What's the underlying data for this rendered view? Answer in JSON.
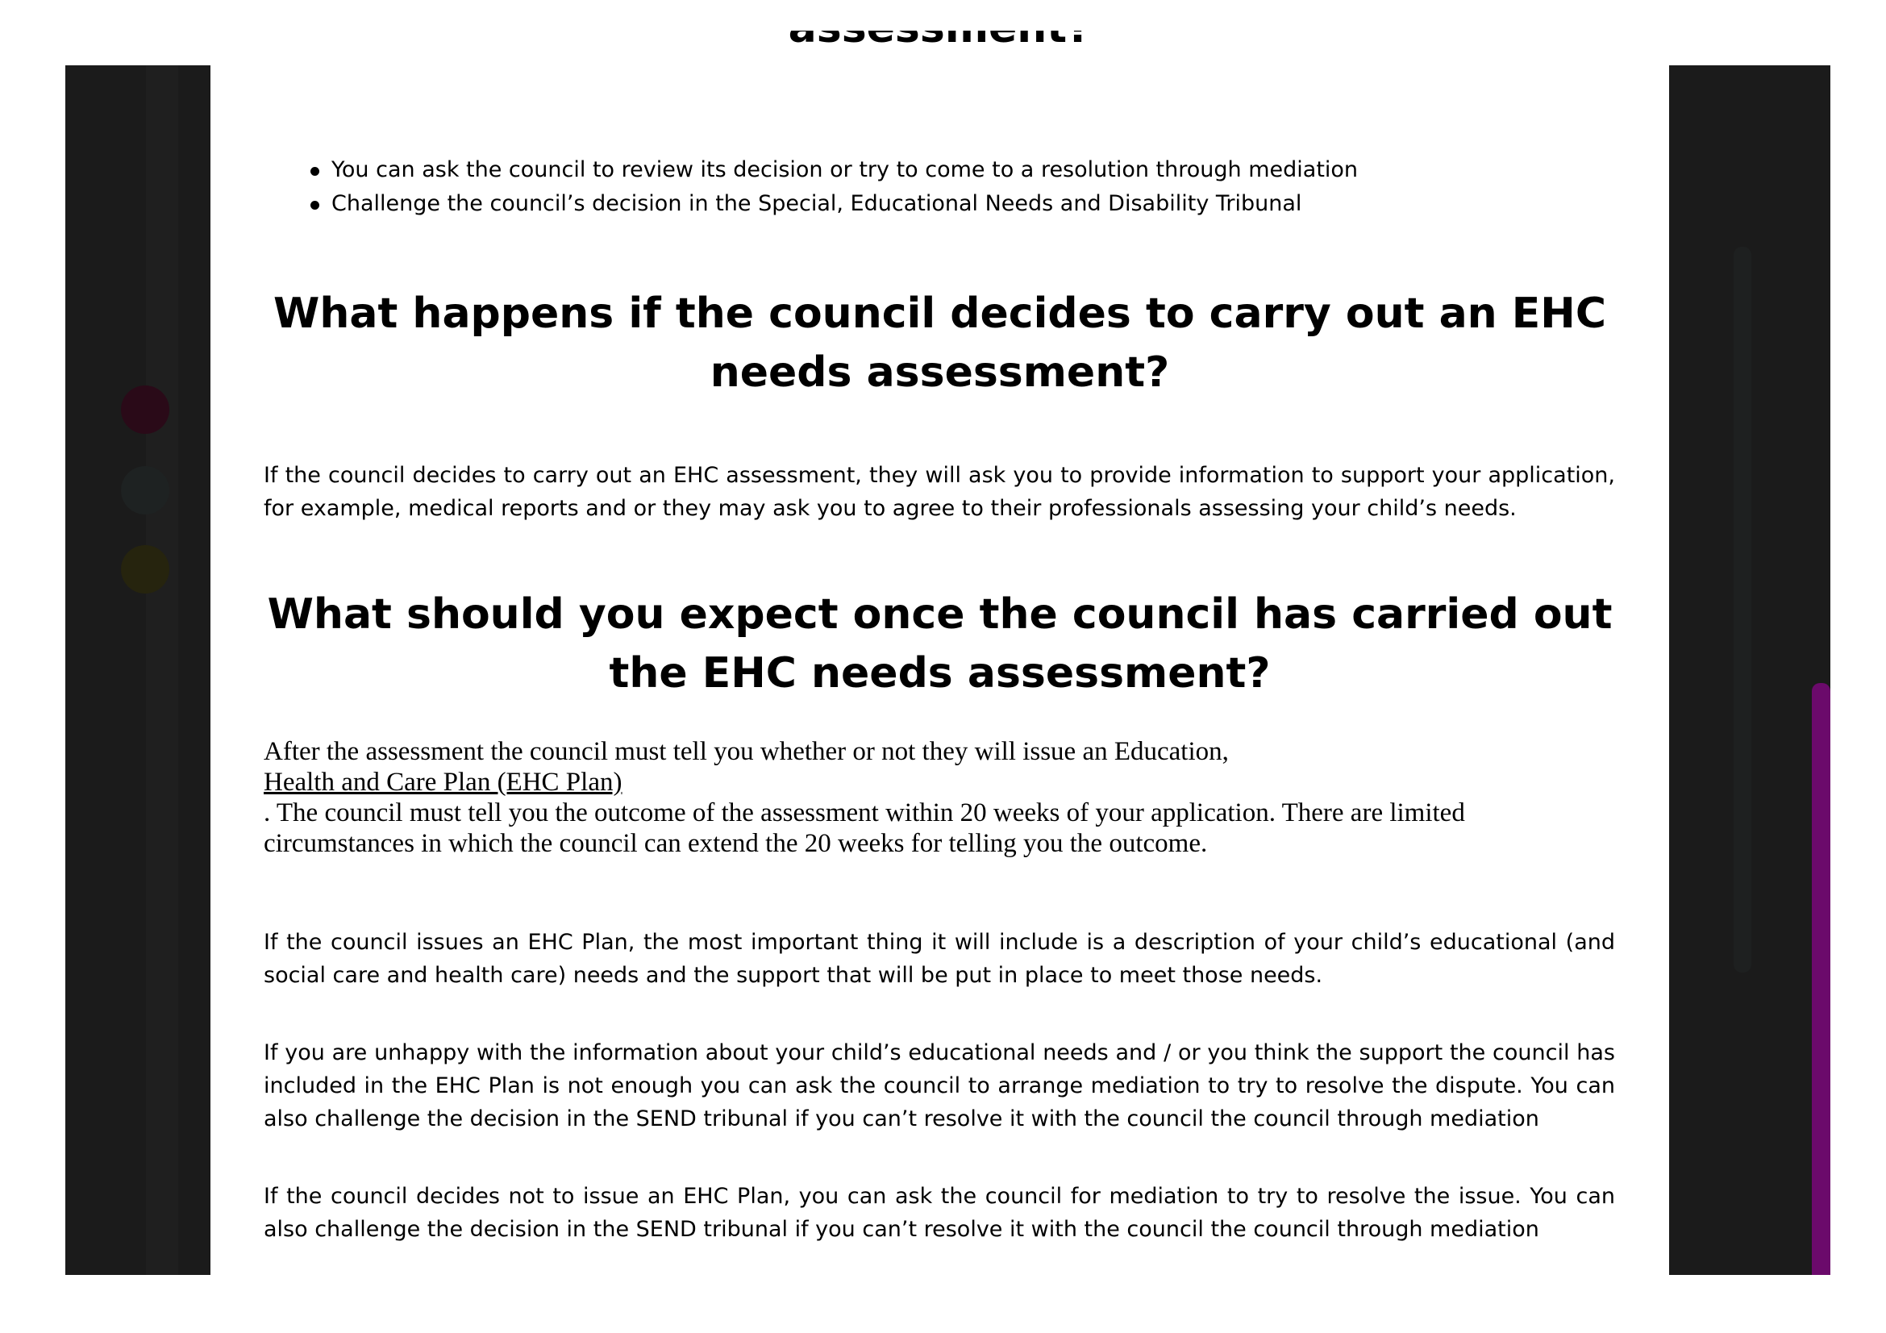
{
  "document": {
    "cut_heading": "assessment?",
    "bullets": [
      "You can ask the council to review its decision or try to come to a resolution through mediation",
      "Challenge the council’s decision in the Special, Educational Needs and Disability Tribunal"
    ],
    "heading_1": "What happens if the council decides to carry out an EHC needs assessment?",
    "paragraph_1": "If the council decides to carry out an EHC assessment, they will ask you to provide information to support your application, for example, medical reports and or they may ask you to agree to their professionals assessing your child’s needs.",
    "heading_2": "What should you expect once the council has carried out the EHC needs assessment?",
    "serif_intro": "After the assessment the council must tell you whether or not they will issue an Education,",
    "serif_link": "Health and Care Plan (EHC Plan)",
    "serif_rest": ". The council must tell you the outcome of the assessment within 20 weeks of your application. There are limited circumstances in which the council can extend the 20 weeks for telling you the outcome.",
    "paragraph_2": "If the council issues an EHC Plan, the most important thing it will include is a description of your child’s educational (and social care and health care) needs and the support that will be put in place to meet those needs.",
    "paragraph_3": "If you are unhappy with the information about your child’s educational needs and / or you think the support the council has included in the EHC Plan is not enough you can ask the council to arrange mediation to try to resolve the dispute. You can also challenge the decision in the SEND tribunal if you can’t resolve it with the council the council through mediation",
    "paragraph_4": "If the council decides not to issue an EHC Plan, you can ask the council for mediation to try to resolve the issue. You can also challenge the decision in the SEND tribunal if you can’t resolve it with the council the council through mediation"
  },
  "colors": {
    "sidebar": "#1b1b1b",
    "scrollbar": "#6b0a6b",
    "text": "#000000"
  }
}
